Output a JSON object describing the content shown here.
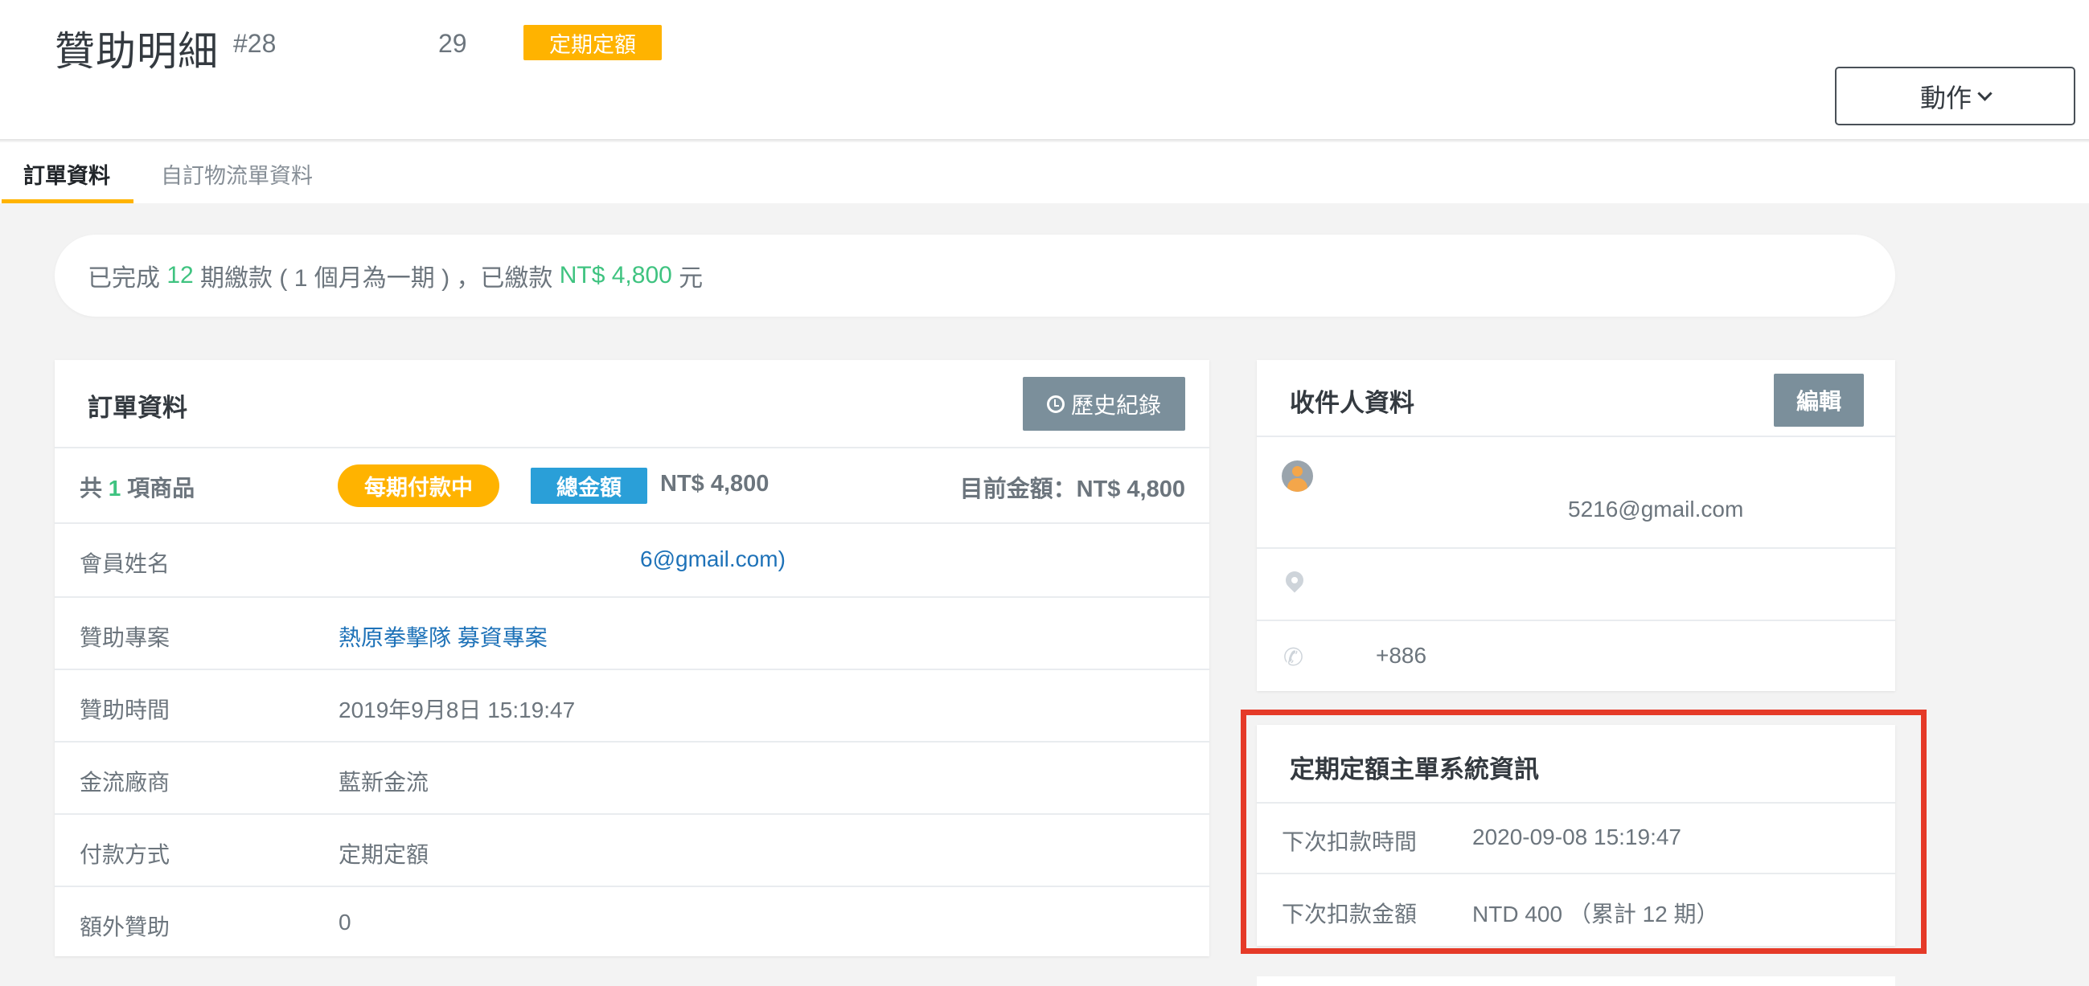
{
  "header": {
    "title": "贊助明細",
    "order_no": "#28",
    "count": "29",
    "type_badge": "定期定額",
    "action_label": "動作"
  },
  "tabs": [
    {
      "label": "訂單資料",
      "active": true
    },
    {
      "label": "自訂物流單資料",
      "active": false
    }
  ],
  "summary": {
    "prefix": "已完成 ",
    "periods": "12",
    "middle": " 期繳款 ( 1 個月為一期 ) ，已繳款 ",
    "paid": "NT$ 4,800",
    "suffix": " 元"
  },
  "order_card": {
    "title": "訂單資料",
    "history_label": "歷史紀錄",
    "items": {
      "prefix": "共 ",
      "count": "1",
      "suffix": " 項商品"
    },
    "status_badge": "每期付款中",
    "total_badge": "總金額",
    "total_amount": "NT$ 4,800",
    "current_amount": "目前金額：NT$ 4,800",
    "rows": [
      {
        "label": "會員姓名",
        "value": "6@gmail.com)"
      },
      {
        "label": "贊助專案",
        "value": "熱原拳擊隊 募資專案"
      },
      {
        "label": "贊助時間",
        "value": "2019年9月8日 15:19:47"
      },
      {
        "label": "金流廠商",
        "value": "藍新金流"
      },
      {
        "label": "付款方式",
        "value": "定期定額"
      },
      {
        "label": "額外贊助",
        "value": "0"
      }
    ]
  },
  "recipient_card": {
    "title": "收件人資料",
    "edit_label": "編輯",
    "email": "5216@gmail.com",
    "phone": "+886"
  },
  "system_card": {
    "title": "定期定額主單系統資訊",
    "next_charge_time_label": "下次扣款時間",
    "next_charge_time": "2020-09-08 15:19:47",
    "next_charge_amount_label": "下次扣款金額",
    "next_charge_amount": "NTD 400 （累計 12 期）"
  },
  "icons": {
    "avatar": "user-avatar-icon",
    "location": "map-pin-icon",
    "phone": "phone-icon",
    "history": "clock-icon",
    "dropdown": "chevron-down-icon"
  },
  "colors": {
    "accent_orange": "#ffb300",
    "accent_green": "#3fc380",
    "link_blue": "#1e72b8",
    "badge_blue": "#2a9fd8",
    "button_gray": "#7b8f9b",
    "highlight_red": "#e53a28"
  }
}
